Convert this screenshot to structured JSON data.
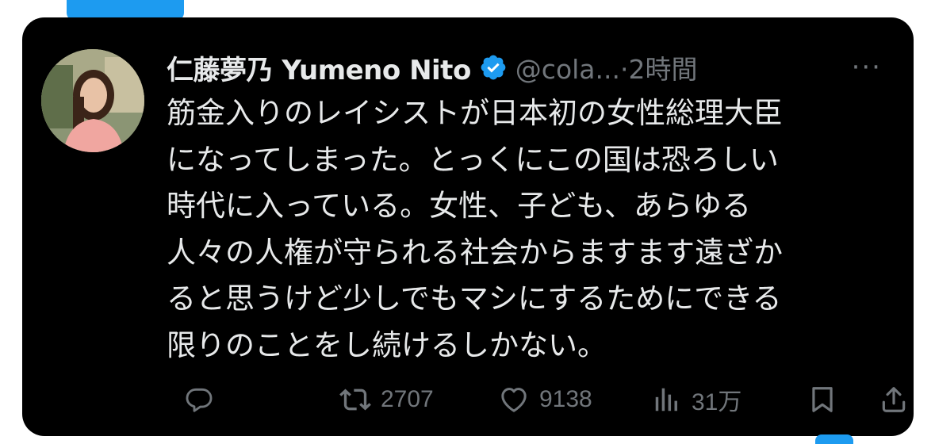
{
  "post": {
    "display_name": "仁藤夢乃  Yumeno Nito",
    "handle_time": "@cola...·2時間",
    "more_label": "···",
    "body_lines": [
      "筋金入りのレイシストが日本初の女性総理大臣",
      "になってしまった。とっくにこの国は恐ろしい",
      "時代に入っている。女性、子ども、あらゆる",
      "人々の人権が守られる社会からますます遠ざか",
      "ると思うけど少しでもマシにするためにできる",
      "限りのことをし続けるしかない。"
    ]
  },
  "actions": {
    "reply_icon": "reply-icon",
    "retweet_icon": "retweet-icon",
    "retweet_count": "2707",
    "like_icon": "heart-icon",
    "like_count": "9138",
    "views_icon": "views-bar-icon",
    "views_count": "31万",
    "bookmark_icon": "bookmark-icon",
    "share_icon": "share-icon"
  },
  "colors": {
    "background": "#000000",
    "text": "#e7e9ea",
    "muted": "#71767b",
    "verified": "#1d9bf0"
  }
}
